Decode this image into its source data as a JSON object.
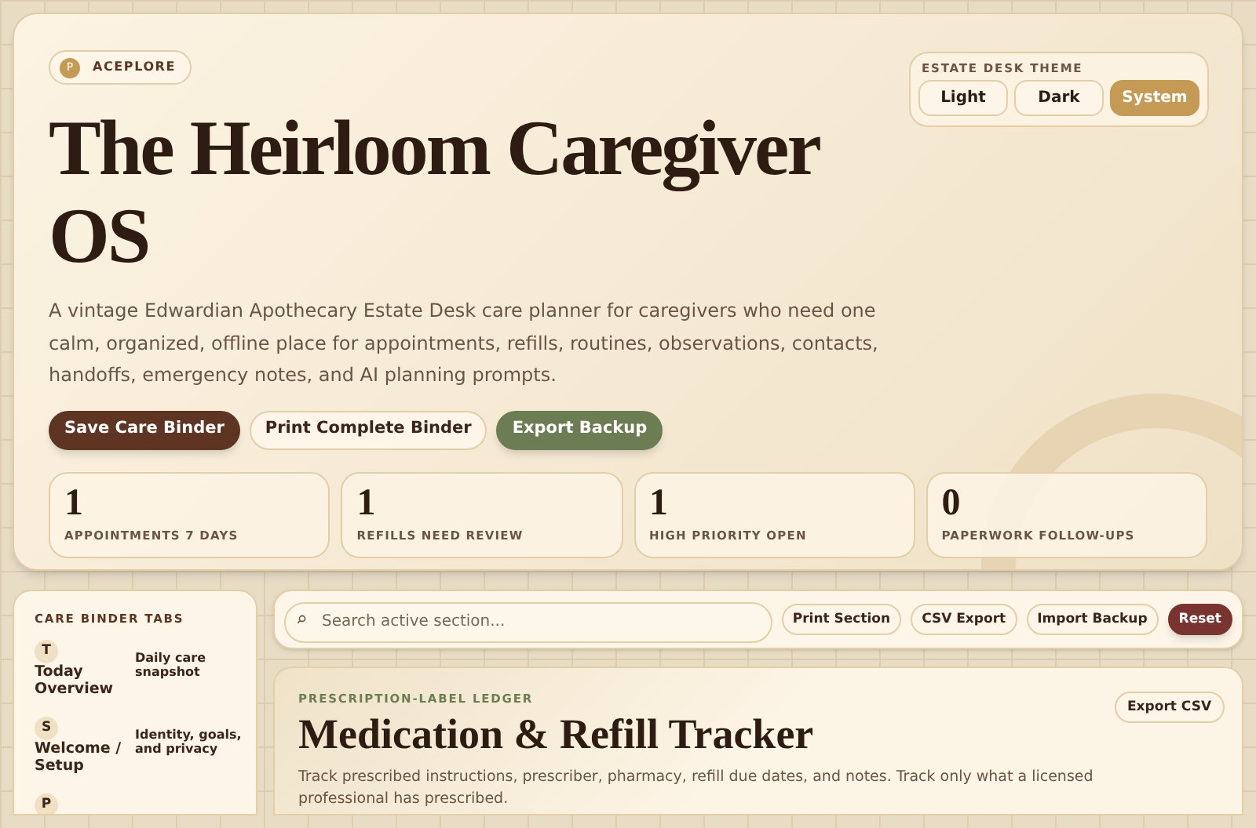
{
  "brand": {
    "initial": "P",
    "name": "ACEPLORE"
  },
  "theme": {
    "label": "ESTATE DESK THEME",
    "options": [
      {
        "label": "Light",
        "selected": false
      },
      {
        "label": "Dark",
        "selected": false
      },
      {
        "label": "System",
        "selected": true
      }
    ]
  },
  "title": "The Heirloom Caregiver OS",
  "description": "A vintage Edwardian Apothecary Estate Desk care planner for caregivers who need one calm, organized, offline place for appointments, refills, routines, observations, contacts, handoffs, emergency notes, and AI planning prompts.",
  "actions": [
    {
      "label": "Save Care Binder",
      "kind": "primary"
    },
    {
      "label": "Print Complete Binder",
      "kind": "secondary"
    },
    {
      "label": "Export Backup",
      "kind": "accent"
    }
  ],
  "stats": [
    {
      "value": "1",
      "label": "APPOINTMENTS 7 DAYS"
    },
    {
      "value": "1",
      "label": "REFILLS NEED REVIEW"
    },
    {
      "value": "1",
      "label": "HIGH PRIORITY OPEN"
    },
    {
      "value": "0",
      "label": "PAPERWORK FOLLOW-UPS"
    }
  ],
  "sidebar": {
    "title": "CARE BINDER TABS",
    "items": [
      {
        "initial": "T",
        "title": "Today Overview",
        "description": "Daily care snapshot"
      },
      {
        "initial": "S",
        "title": "Welcome / Setup",
        "description": "Identity, goals, and privacy"
      },
      {
        "initial": "P"
      }
    ]
  },
  "toolbar": {
    "search": {
      "placeholder": "Search active section..."
    },
    "buttons": [
      {
        "label": "Print Section",
        "kind": "secondary"
      },
      {
        "label": "CSV Export",
        "kind": "secondary"
      },
      {
        "label": "Import Backup",
        "kind": "secondary"
      },
      {
        "label": "Reset",
        "kind": "danger"
      }
    ]
  },
  "section": {
    "eyebrow": "PRESCRIPTION-LABEL LEDGER",
    "title": "Medication & Refill Tracker",
    "description": "Track prescribed instructions, prescriber, pharmacy, refill due dates, and notes. Track only what a licensed professional has prescribed.",
    "button": "Export CSV"
  }
}
